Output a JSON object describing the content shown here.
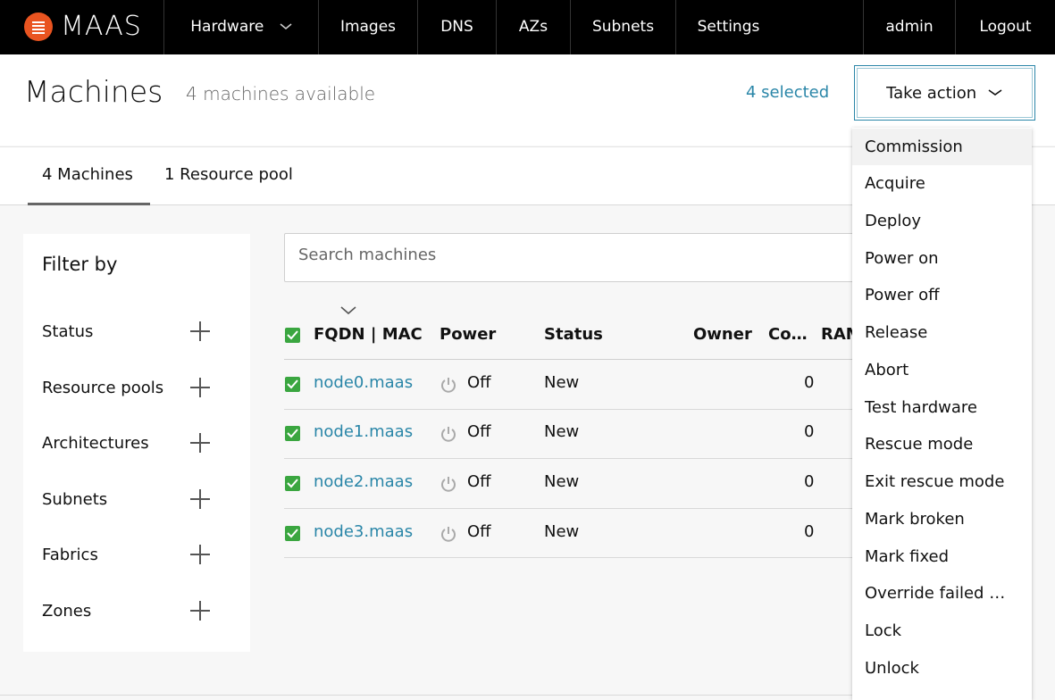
{
  "nav": {
    "brand": "MAAS",
    "items": [
      "Hardware",
      "Images",
      "DNS",
      "AZs",
      "Subnets",
      "Settings",
      "admin",
      "Logout"
    ]
  },
  "header": {
    "title": "Machines",
    "subtitle": "4 machines available",
    "selected": "4 selected",
    "take_action": "Take action"
  },
  "tabs": [
    "4 Machines",
    "1 Resource pool"
  ],
  "filter": {
    "title": "Filter by",
    "items": [
      "Status",
      "Resource pools",
      "Architectures",
      "Subnets",
      "Fabrics",
      "Zones"
    ]
  },
  "search": {
    "placeholder": "Search machines"
  },
  "table": {
    "headers": [
      "FQDN | MAC",
      "Power",
      "Status",
      "Owner",
      "Co…",
      "RAM"
    ],
    "rows": [
      {
        "fqdn": "node0.maas",
        "power": "Off",
        "status": "New",
        "cores": "0"
      },
      {
        "fqdn": "node1.maas",
        "power": "Off",
        "status": "New",
        "cores": "0"
      },
      {
        "fqdn": "node2.maas",
        "power": "Off",
        "status": "New",
        "cores": "0"
      },
      {
        "fqdn": "node3.maas",
        "power": "Off",
        "status": "New",
        "cores": "0"
      }
    ]
  },
  "actions": [
    "Commission",
    "Acquire",
    "Deploy",
    "Power on",
    "Power off",
    "Release",
    "Abort",
    "Test hardware",
    "Rescue mode",
    "Exit rescue mode",
    "Mark broken",
    "Mark fixed",
    "Override failed …",
    "Lock",
    "Unlock"
  ],
  "colors": {
    "brand": "#e95420",
    "link": "#2a86a8",
    "checkbox": "#3aa640",
    "nav_bg": "#000000"
  }
}
